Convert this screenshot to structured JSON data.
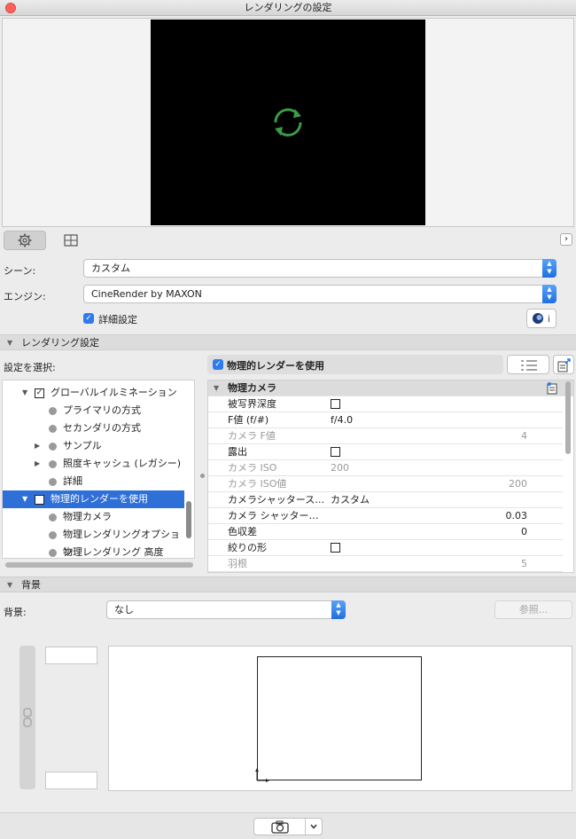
{
  "window": {
    "title": "レンダリングの設定"
  },
  "tabs": {
    "settings_icon": "gear-icon",
    "view_icon": "grid-view-icon",
    "expand_icon": "chevron-right-icon",
    "expand_glyph": "›"
  },
  "scene": {
    "label": "シーン:",
    "value": "カスタム"
  },
  "engine": {
    "label": "エンジン:",
    "value": "CineRender by MAXON"
  },
  "detail": {
    "label": "詳細設定",
    "checked": true
  },
  "render_section": {
    "title": "レンダリング設定"
  },
  "select_settings": {
    "label": "設定を選択:"
  },
  "physical_toggle": {
    "label": "物理的レンダーを使用",
    "checked": true
  },
  "tree": {
    "global_illumination": "グローバルイルミネーション",
    "primary": "プライマリの方式",
    "secondary": "セカンダリの方式",
    "sample": "サンプル",
    "irradiance": "照度キャッシュ (レガシー)",
    "detail": "詳細",
    "physical_render": "物理的レンダーを使用",
    "physical_camera": "物理カメラ",
    "physical_options": "物理レンダリングオプション",
    "physical_advanced": "物理レンダリング 高度"
  },
  "props": {
    "header": "物理カメラ",
    "rows": {
      "dof": "被写界深度",
      "fnum": "F値 (f/#)",
      "fnum_val": "f/4.0",
      "cam_f": "カメラ F値",
      "cam_f_val": "4",
      "exposure": "露出",
      "iso": "カメラ ISO",
      "iso_val": "200",
      "iso_value": "カメラ ISO値",
      "iso_value_val": "200",
      "shutter": "カメラシャッタース…",
      "shutter_val": "カスタム",
      "shutter2": "カメラ シャッター…",
      "shutter2_val": "0.03",
      "chroma": "色収差",
      "chroma_val": "0",
      "aperture": "絞りの形",
      "blades": "羽根",
      "blades_val": "5"
    }
  },
  "background_section": {
    "title": "背景"
  },
  "background": {
    "label": "背景:",
    "value": "なし",
    "browse": "参照..."
  },
  "bottom": {
    "camera_icon": "camera-icon",
    "menu_icon": "chevron-down-icon"
  }
}
